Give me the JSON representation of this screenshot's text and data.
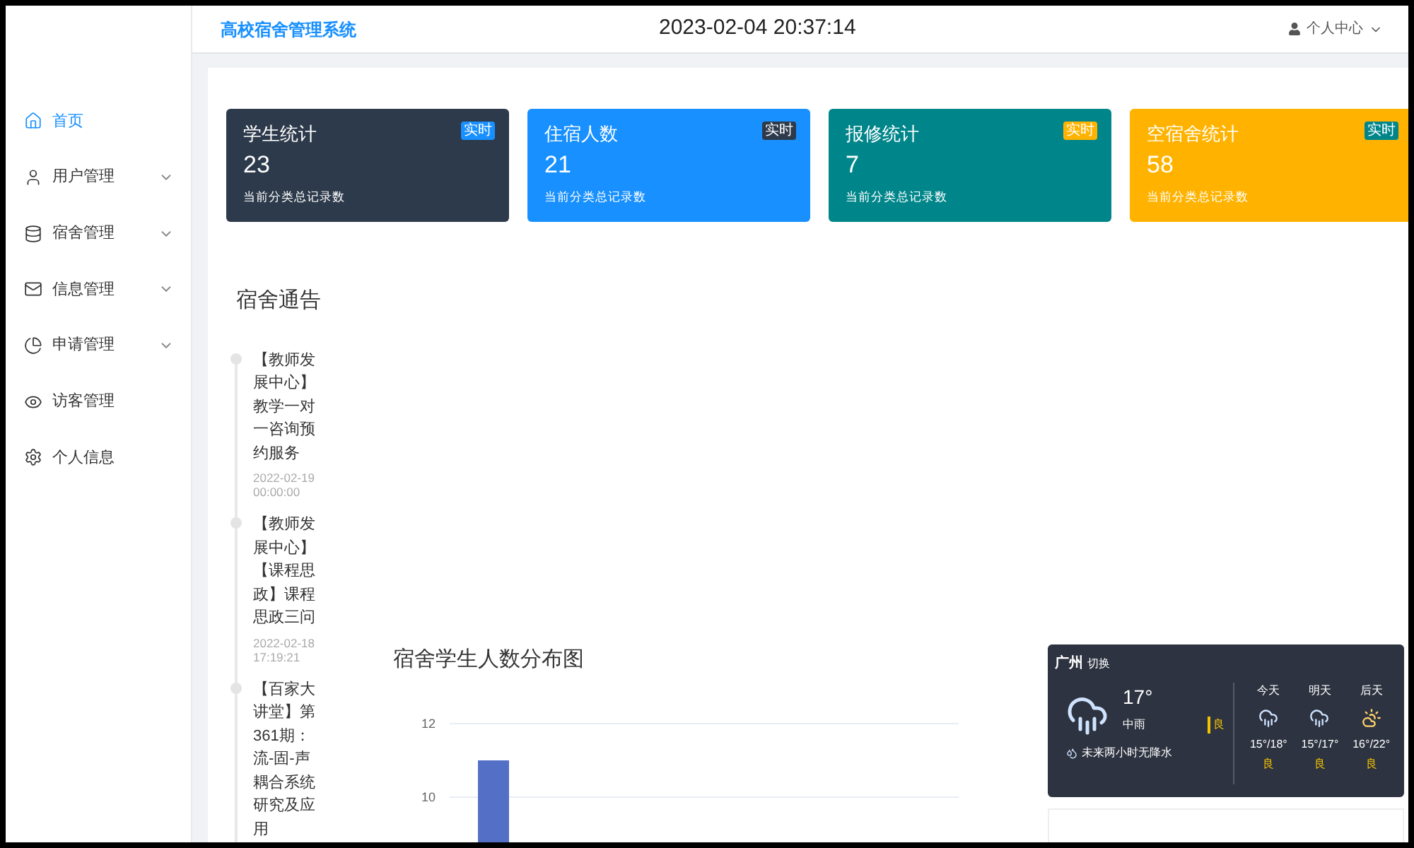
{
  "header": {
    "title": "高校宿舍管理系统",
    "clock": "2023-02-04 20:37:14",
    "user_menu": "个人中心"
  },
  "sidebar": {
    "items": [
      {
        "label": "首页",
        "selected": true,
        "has_submenu": false
      },
      {
        "label": "用户管理",
        "selected": false,
        "has_submenu": true
      },
      {
        "label": "宿舍管理",
        "selected": false,
        "has_submenu": true
      },
      {
        "label": "信息管理",
        "selected": false,
        "has_submenu": true
      },
      {
        "label": "申请管理",
        "selected": false,
        "has_submenu": true
      },
      {
        "label": "访客管理",
        "selected": false,
        "has_submenu": false
      },
      {
        "label": "个人信息",
        "selected": false,
        "has_submenu": false
      }
    ]
  },
  "stat_cards": [
    {
      "title": "学生统计",
      "badge": "实时",
      "value": "23",
      "caption": "当前分类总记录数",
      "color": "#2d3a4b"
    },
    {
      "title": "住宿人数",
      "badge": "实时",
      "value": "21",
      "caption": "当前分类总记录数",
      "color": "#1890ff"
    },
    {
      "title": "报修统计",
      "badge": "实时",
      "value": "7",
      "caption": "当前分类总记录数",
      "color": "#00868a"
    },
    {
      "title": "空宿舍统计",
      "badge": "实时",
      "value": "58",
      "caption": "当前分类总记录数",
      "color": "#ffb300"
    }
  ],
  "notices": {
    "title": "宿舍通告",
    "items": [
      {
        "text": "【教师发展中心】教学一对一咨询预约服务",
        "time": "2022-02-19 00:00:00"
      },
      {
        "text": "【教师发展中心】【课程思政】课程思政三问",
        "time": "2022-02-18 17:19:21"
      },
      {
        "text": "【百家大讲堂】第361期：流-固-声耦合系统研究及应用"
      }
    ]
  },
  "chart": {
    "title": "宿舍学生人数分布图",
    "chart_data": {
      "type": "bar",
      "ylim": [
        0,
        12
      ],
      "yticks": [
        10,
        12
      ],
      "values": [
        11
      ]
    }
  },
  "weather": {
    "city": "广州",
    "switch": "切换",
    "temperature": "17°",
    "condition": "中雨",
    "air_quality": "良",
    "forecast_note": "未来两小时无降水",
    "days": [
      {
        "label": "今天",
        "kind": "rain",
        "range": "15°/18°",
        "air_quality": "良"
      },
      {
        "label": "明天",
        "kind": "rain",
        "range": "15°/17°",
        "air_quality": "良"
      },
      {
        "label": "后天",
        "kind": "sun",
        "range": "16°/22°",
        "air_quality": "良"
      }
    ]
  }
}
